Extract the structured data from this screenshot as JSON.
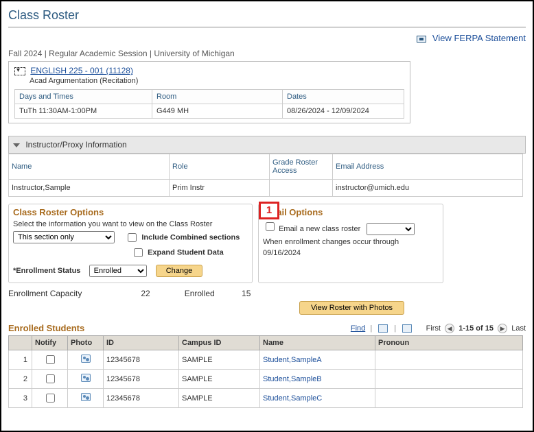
{
  "pageTitle": "Class Roster",
  "ferpaLabel": "View FERPA Statement",
  "breadcrumb": "Fall 2024 | Regular Academic Session | University of Michigan",
  "course": {
    "link": "ENGLISH 225 - 001 (11128)",
    "sub": "Acad Argumentation (Recitation)"
  },
  "meeting": {
    "headers": {
      "days": "Days and Times",
      "room": "Room",
      "dates": "Dates"
    },
    "days": "TuTh 11:30AM-1:00PM",
    "room": "G449 MH",
    "dates": "08/26/2024 - 12/09/2024"
  },
  "instructor": {
    "panelTitle": "Instructor/Proxy Information",
    "headers": {
      "name": "Name",
      "role": "Role",
      "gr": "Grade Roster Access",
      "email": "Email Address"
    },
    "name": "Instructor,Sample",
    "role": "Prim Instr",
    "grAccess": "",
    "email": "instructor@umich.edu"
  },
  "rosterOptions": {
    "title": "Class Roster Options",
    "desc": "Select the information you want to view on the Class Roster",
    "sectionSelect": "This section only",
    "combinedLabel": "Include Combined sections",
    "expandLabel": "Expand Student Data",
    "enrollStatusLabel": "*Enrollment Status",
    "enrollStatusValue": "Enrolled",
    "changeBtn": "Change",
    "callout": "1"
  },
  "emailOptions": {
    "title": "Email Options",
    "checkboxLabel": "Email a new class roster",
    "note1": "When enrollment changes occur through",
    "note2": "09/16/2024"
  },
  "capacity": {
    "capLabel": "Enrollment Capacity",
    "capValue": "22",
    "enrLabel": "Enrolled",
    "enrValue": "15"
  },
  "viewPhotosBtn": "View Roster with Photos",
  "enrolled": {
    "title": "Enrolled Students",
    "findLabel": "Find",
    "firstLabel": "First",
    "rangeLabel": "1-15 of 15",
    "lastLabel": "Last",
    "headers": {
      "notify": "Notify",
      "photo": "Photo",
      "id": "ID",
      "campus": "Campus ID",
      "name": "Name",
      "pronoun": "Pronoun"
    },
    "rows": [
      {
        "n": "1",
        "id": "12345678",
        "campus": "SAMPLE",
        "name": "Student,SampleA"
      },
      {
        "n": "2",
        "id": "12345678",
        "campus": "SAMPLE",
        "name": "Student,SampleB"
      },
      {
        "n": "3",
        "id": "12345678",
        "campus": "SAMPLE",
        "name": "Student,SampleC"
      }
    ]
  }
}
